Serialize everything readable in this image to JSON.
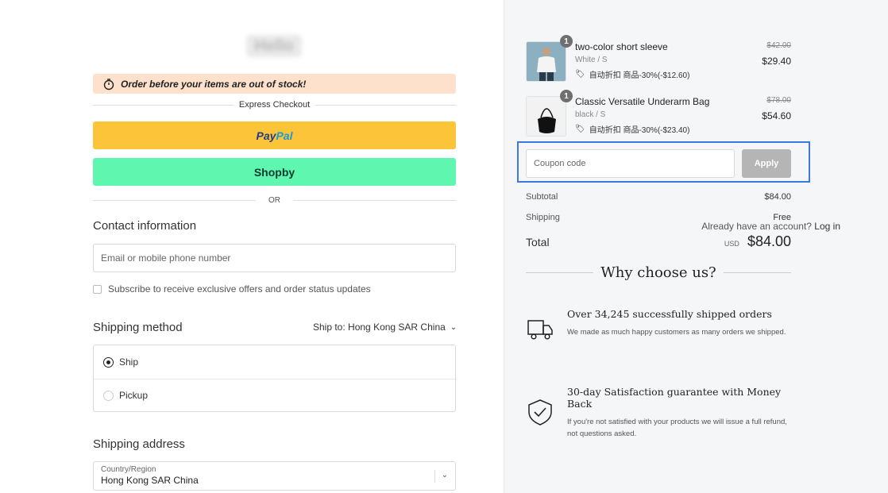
{
  "banner": {
    "text": "Order before your items are out of stock!"
  },
  "express": {
    "label": "Express Checkout",
    "paypal_part1": "Pay",
    "paypal_part2": "Pal",
    "shopby": "Shopby",
    "or": "OR"
  },
  "contact": {
    "title": "Contact information",
    "account_text": "Already have an account?",
    "login_link": "Log in",
    "email_placeholder": "Email or mobile phone number",
    "subscribe_label": "Subscribe to receive exclusive offers and order status updates"
  },
  "shipping_method": {
    "title": "Shipping method",
    "ship_to_label": "Ship to:",
    "ship_to_value": "Hong Kong SAR China",
    "options": [
      {
        "label": "Ship",
        "selected": true
      },
      {
        "label": "Pickup",
        "selected": false
      }
    ]
  },
  "shipping_address": {
    "title": "Shipping address",
    "country_label": "Country/Region",
    "country_value": "Hong Kong SAR China"
  },
  "cart": {
    "items": [
      {
        "qty": "1",
        "name": "two-color short sleeve",
        "variant": "White / S",
        "discount": "自动折扣 商品-30%(-$12.60)",
        "price_old": "$42.00",
        "price_new": "$29.40",
        "thumb_icon": "tshirt-model-photo"
      },
      {
        "qty": "1",
        "name": "Classic Versatile Underarm Bag",
        "variant": "black / S",
        "discount": "自动折扣 商品-30%(-$23.40)",
        "price_old": "$78.00",
        "price_new": "$54.60",
        "thumb_icon": "bag-photo"
      }
    ],
    "coupon_placeholder": "Coupon code",
    "apply_label": "Apply",
    "subtotal_label": "Subtotal",
    "subtotal_value": "$84.00",
    "shipping_label": "Shipping",
    "shipping_value": "Free",
    "total_label": "Total",
    "total_currency": "USD",
    "total_value": "$84.00"
  },
  "why": {
    "title": "Why choose us?",
    "features": [
      {
        "icon": "truck-icon",
        "title": "Over 34,245 successfully shipped orders",
        "desc": "We made as much happy customers as many orders we shipped."
      },
      {
        "icon": "shield-check-icon",
        "title": "30-day Satisfaction guarantee with Money Back",
        "desc": "If you're not satisfied with your products we will issue a full refund, not questions asked."
      }
    ]
  }
}
